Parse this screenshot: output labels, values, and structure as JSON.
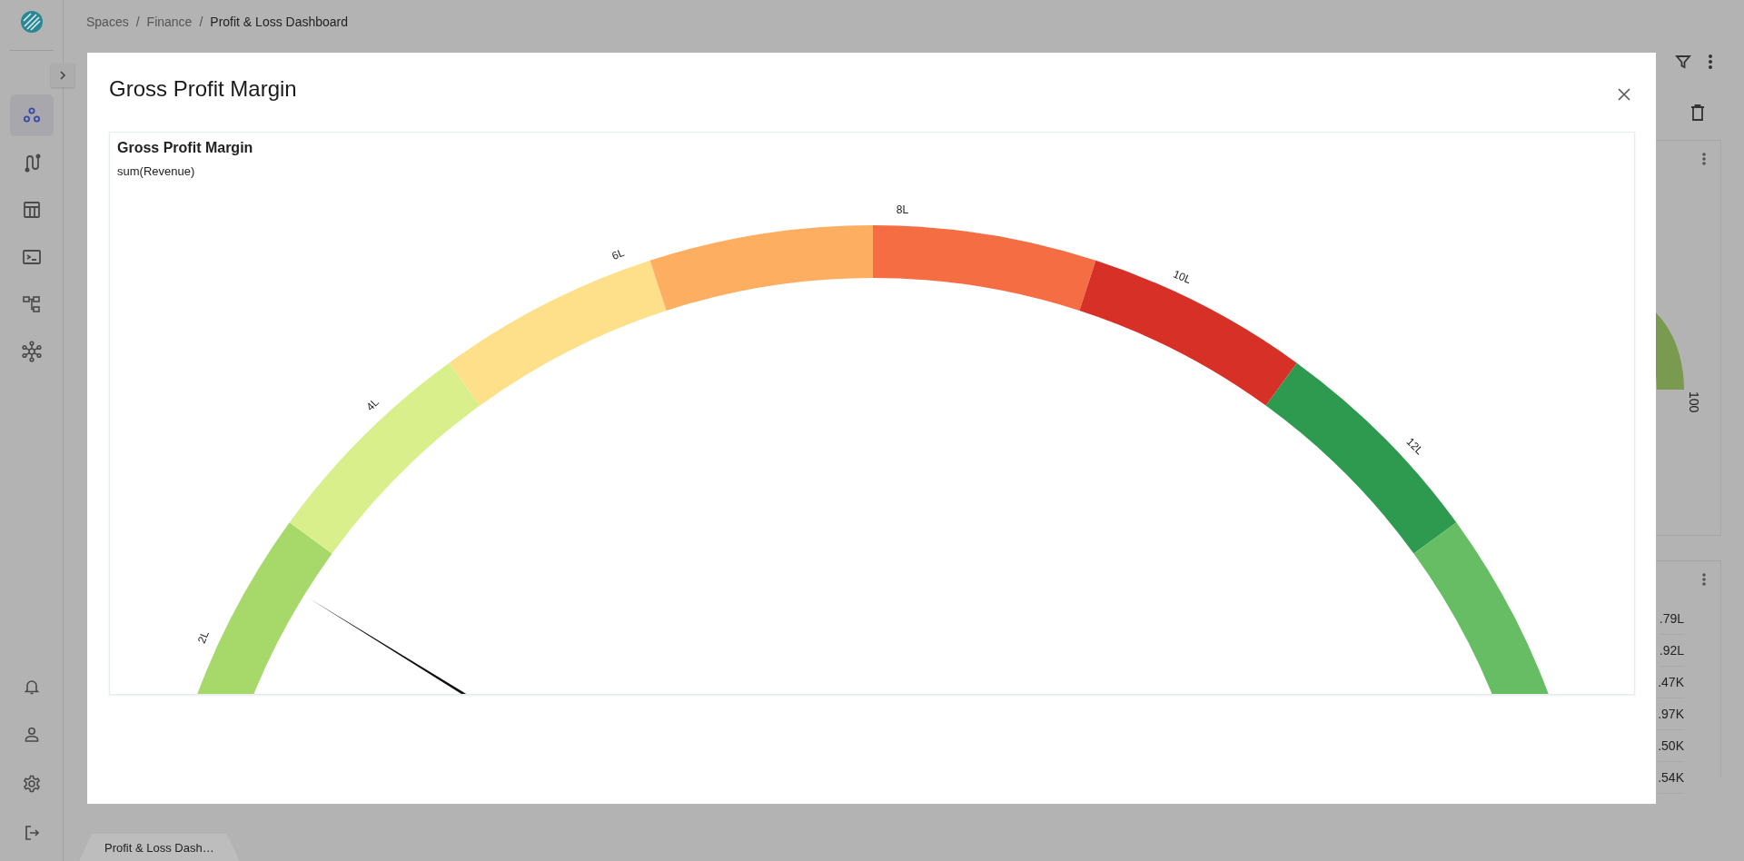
{
  "breadcrumb": {
    "separator": "/",
    "items": [
      {
        "label": "Spaces"
      },
      {
        "label": "Finance"
      },
      {
        "label": "Profit & Loss Dashboard"
      }
    ]
  },
  "sidebar": {
    "items": [
      {
        "selected": true
      },
      {
        "selected": false
      },
      {
        "selected": false
      },
      {
        "selected": false
      },
      {
        "selected": false
      },
      {
        "selected": false
      }
    ]
  },
  "background_cards": [
    {
      "gauge_label": "100"
    },
    {
      "values": [
        ".79L",
        ".92L",
        ".47K",
        ".97K",
        ".50K",
        ".54K"
      ]
    }
  ],
  "modal": {
    "title": "Gross Profit Margin",
    "chart": {
      "title": "Gross Profit Margin",
      "subtitle": "sum(Revenue)",
      "gauge": {
        "segments": [
          {
            "color": "#a6d96a"
          },
          {
            "color": "#d9ef8b"
          },
          {
            "color": "#fee08b"
          },
          {
            "color": "#fdae61"
          },
          {
            "color": "#f46d43"
          },
          {
            "color": "#d73027"
          },
          {
            "color": "#2e9a4f"
          },
          {
            "color": "#66bd63"
          }
        ],
        "ticks": [
          "2L",
          "4L",
          "6L",
          "8L",
          "10L",
          "12L"
        ],
        "level": 0.176
      }
    }
  },
  "tabs": [
    {
      "label": "Profit & Loss Dash…",
      "selected": true
    }
  ]
}
